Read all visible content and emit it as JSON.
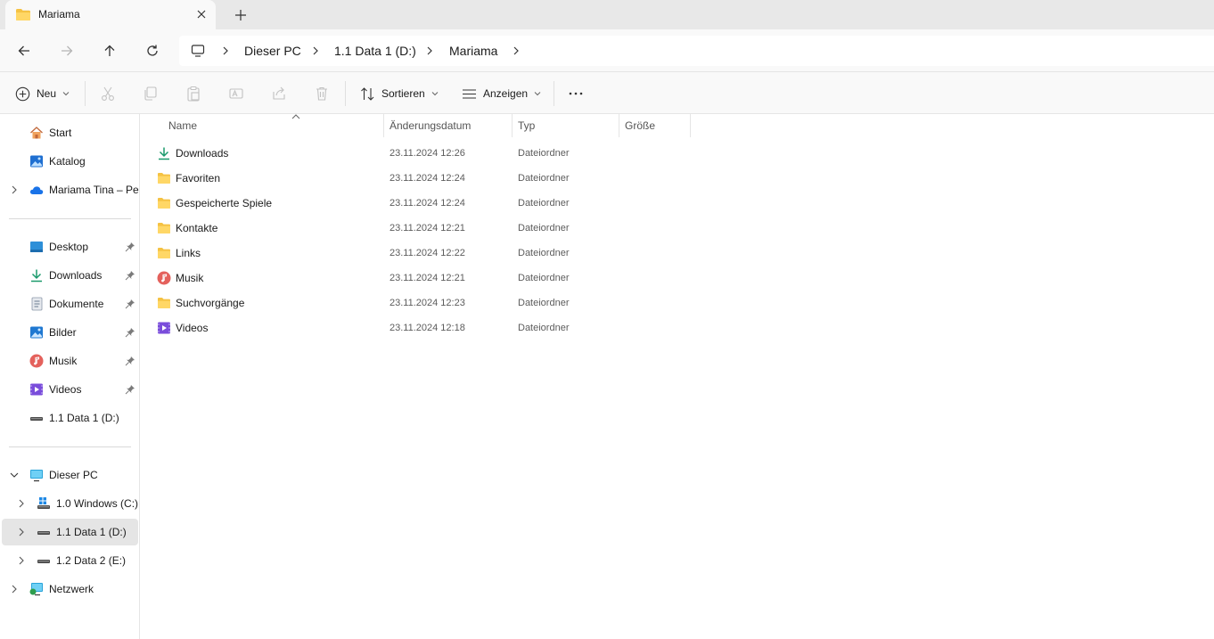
{
  "window": {
    "tab_title": "Mariama",
    "new_tab": "+"
  },
  "breadcrumb": [
    "Dieser PC",
    "1.1 Data 1 (D:)",
    "Mariama"
  ],
  "toolbar": {
    "new_label": "Neu",
    "sort_label": "Sortieren",
    "view_label": "Anzeigen",
    "more_label": "···"
  },
  "sidebar": {
    "top": [
      {
        "label": "Start",
        "icon": "home-icon"
      },
      {
        "label": "Katalog",
        "icon": "gallery-icon"
      },
      {
        "label": "Mariama Tina – Per",
        "icon": "onedrive-icon"
      }
    ],
    "quick": [
      {
        "label": "Desktop",
        "icon": "desktop-icon"
      },
      {
        "label": "Downloads",
        "icon": "download-icon"
      },
      {
        "label": "Dokumente",
        "icon": "document-icon"
      },
      {
        "label": "Bilder",
        "icon": "pictures-icon"
      },
      {
        "label": "Musik",
        "icon": "music-icon"
      },
      {
        "label": "Videos",
        "icon": "videos-icon"
      },
      {
        "label": "1.1 Data 1 (D:)",
        "icon": "drive-icon"
      }
    ],
    "pc": {
      "label": "Dieser PC",
      "icon": "pc-icon"
    },
    "drives": [
      {
        "label": "1.0 Windows (C:)",
        "icon": "windows-drive-icon"
      },
      {
        "label": "1.1 Data 1 (D:)",
        "icon": "drive-icon"
      },
      {
        "label": "1.2 Data 2 (E:)",
        "icon": "drive-icon"
      }
    ],
    "network": {
      "label": "Netzwerk",
      "icon": "network-icon"
    }
  },
  "columns": {
    "name": "Name",
    "date": "Änderungsdatum",
    "type": "Typ",
    "size": "Größe"
  },
  "files": [
    {
      "name": "Downloads",
      "date": "23.11.2024 12:26",
      "type": "Dateiordner",
      "icon": "download-icon"
    },
    {
      "name": "Favoriten",
      "date": "23.11.2024 12:24",
      "type": "Dateiordner",
      "icon": "folder-icon"
    },
    {
      "name": "Gespeicherte Spiele",
      "date": "23.11.2024 12:24",
      "type": "Dateiordner",
      "icon": "folder-icon"
    },
    {
      "name": "Kontakte",
      "date": "23.11.2024 12:21",
      "type": "Dateiordner",
      "icon": "folder-icon"
    },
    {
      "name": "Links",
      "date": "23.11.2024 12:22",
      "type": "Dateiordner",
      "icon": "folder-icon"
    },
    {
      "name": "Musik",
      "date": "23.11.2024 12:21",
      "type": "Dateiordner",
      "icon": "music-icon"
    },
    {
      "name": "Suchvorgänge",
      "date": "23.11.2024 12:23",
      "type": "Dateiordner",
      "icon": "folder-icon"
    },
    {
      "name": "Videos",
      "date": "23.11.2024 12:18",
      "type": "Dateiordner",
      "icon": "videos-icon"
    }
  ]
}
